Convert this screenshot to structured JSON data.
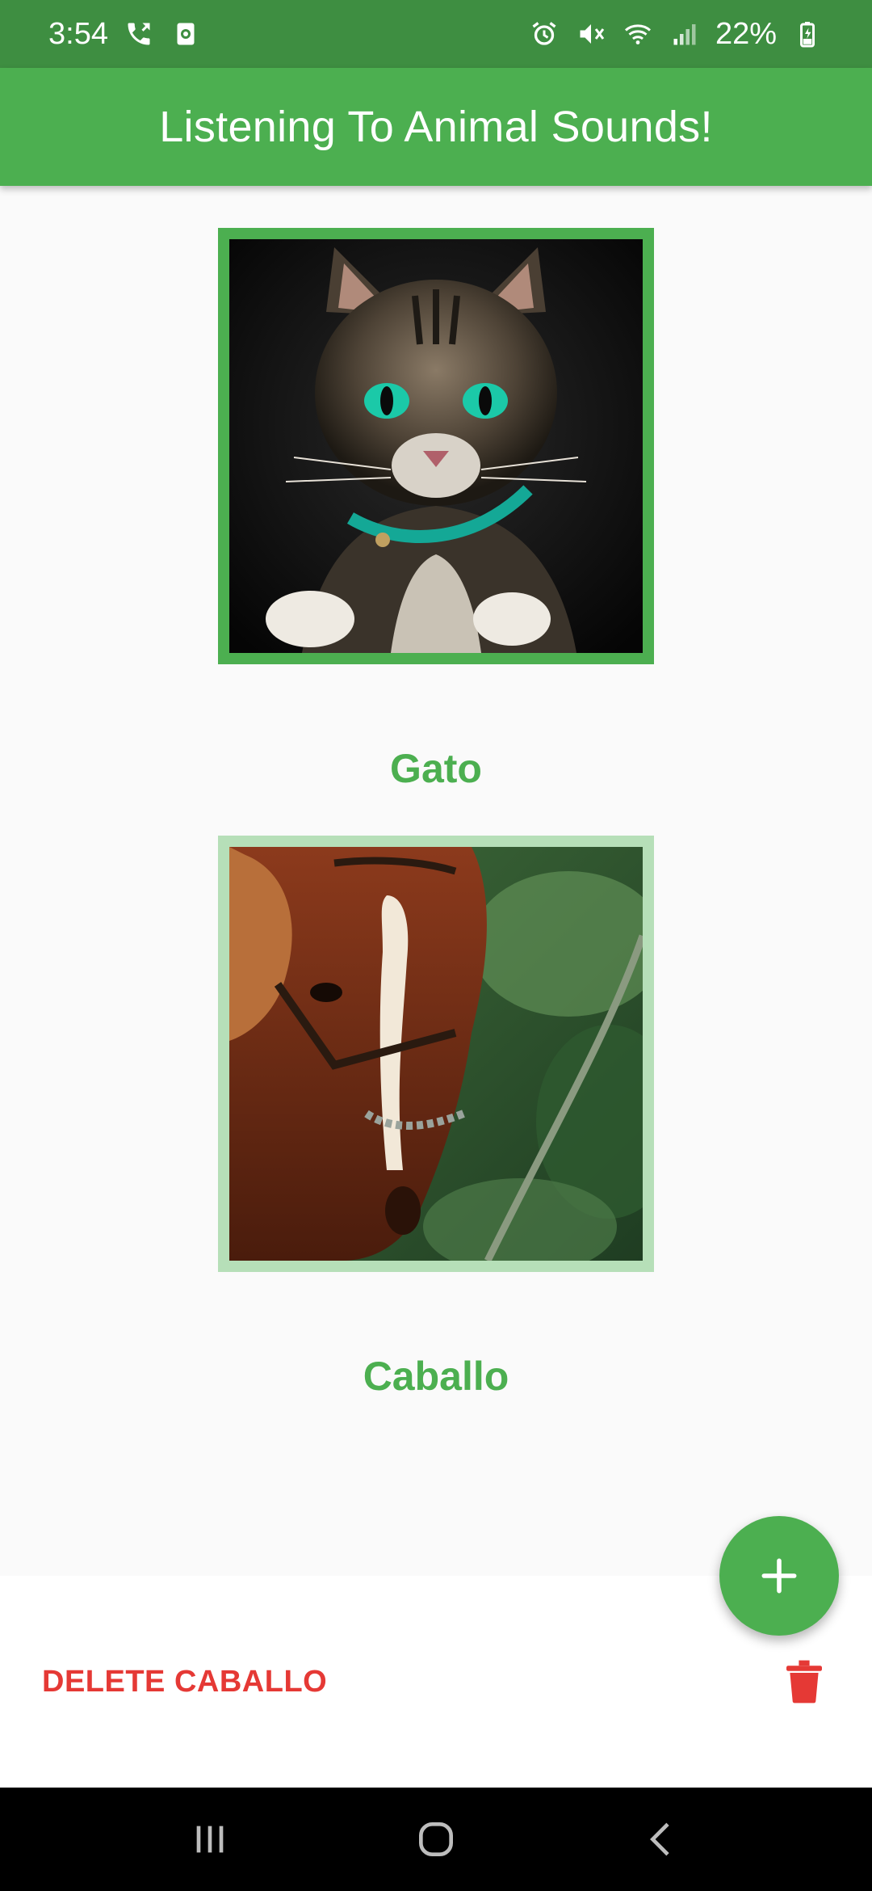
{
  "status_bar": {
    "time": "3:54",
    "battery": "22%",
    "left_icons": [
      "call-forward-icon",
      "screen-record-icon"
    ],
    "right_icons": [
      "alarm-icon",
      "mute-icon",
      "wifi-icon",
      "signal-icon",
      "battery-charging-icon"
    ]
  },
  "app_bar": {
    "title": "Listening To Animal Sounds!"
  },
  "animals": [
    {
      "name": "Gato",
      "image": "cat-photo",
      "selected": false
    },
    {
      "name": "Caballo",
      "image": "horse-photo",
      "selected": true
    }
  ],
  "fab": {
    "icon": "plus-icon"
  },
  "bottom_sheet": {
    "delete_label": "DELETE CABALLO",
    "icon": "trash-icon"
  },
  "nav_bar": {
    "icons": [
      "recent-apps-icon",
      "home-icon",
      "back-icon"
    ]
  },
  "colors": {
    "primary": "#4caf50",
    "status_bar": "#3e8e41",
    "selected_border": "#b6dfb8",
    "delete": "#e53935"
  }
}
